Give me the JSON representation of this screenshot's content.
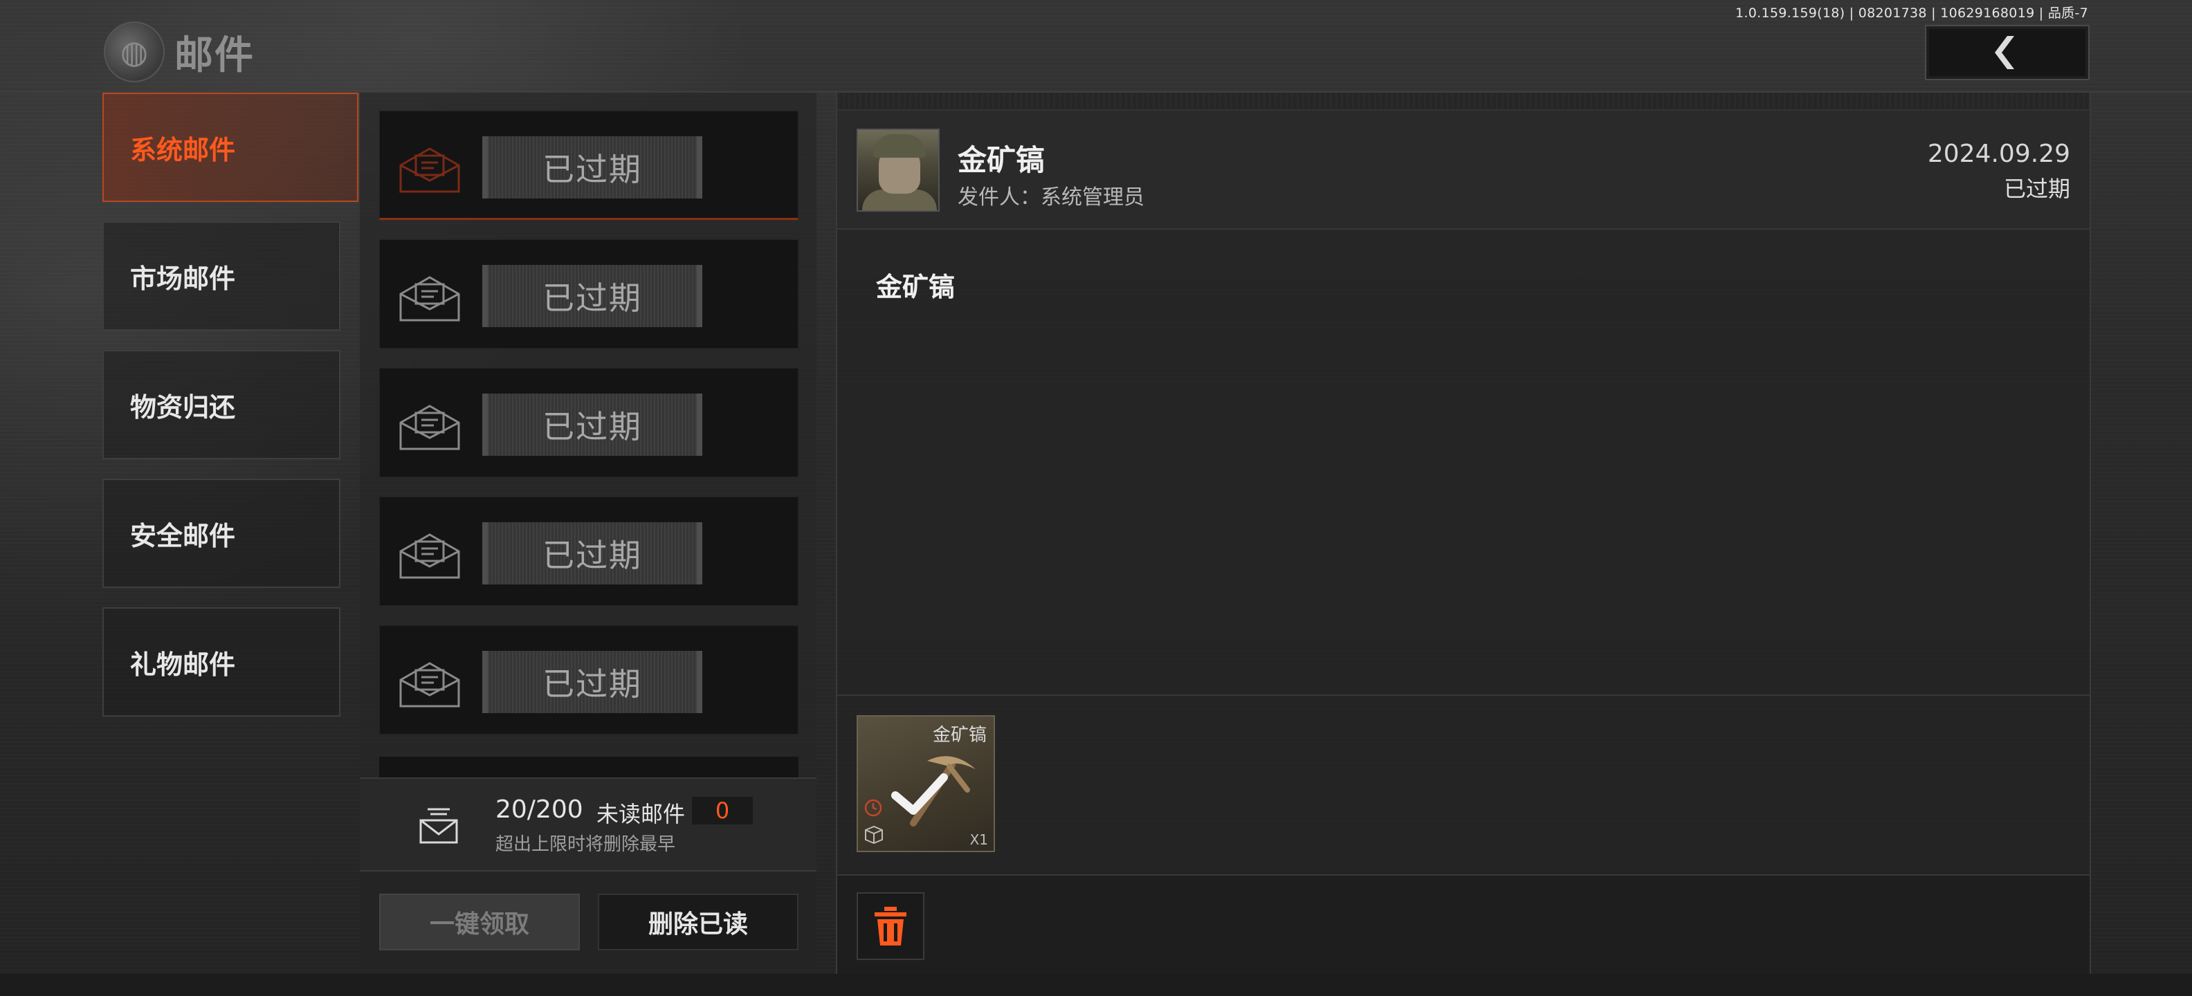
{
  "version_info": "1.0.159.159(18) | 08201738 | 10629168019 | 品质-7",
  "header": {
    "title": "邮件",
    "back_icon": "chevron-left-icon"
  },
  "categories": [
    {
      "label": "系统邮件",
      "active": true
    },
    {
      "label": "市场邮件",
      "active": false
    },
    {
      "label": "物资归还",
      "active": false
    },
    {
      "label": "安全邮件",
      "active": false
    },
    {
      "label": "礼物邮件",
      "active": false
    }
  ],
  "mail_list": {
    "items": [
      {
        "status": "已过期",
        "icon": "open-envelope-icon",
        "selected": true
      },
      {
        "status": "已过期",
        "icon": "open-envelope-icon",
        "selected": false
      },
      {
        "status": "已过期",
        "icon": "open-envelope-icon",
        "selected": false
      },
      {
        "status": "已过期",
        "icon": "open-envelope-icon",
        "selected": false
      },
      {
        "status": "已过期",
        "icon": "open-envelope-icon",
        "selected": false
      }
    ]
  },
  "stats": {
    "count": "20/200",
    "unread_label": "未读邮件",
    "unread_count": "0",
    "note": "超出上限时将删除最早"
  },
  "actions": {
    "claim_all": "一键领取",
    "delete_read": "删除已读"
  },
  "detail": {
    "title": "金矿镐",
    "sender": "发件人：系统管理员",
    "date": "2024.09.29",
    "status": "已过期",
    "body": "金矿镐",
    "attachment": {
      "name": "金矿镐",
      "quantity": "X1",
      "claimed": true
    },
    "delete_icon": "trash-icon"
  },
  "colors": {
    "accent": "#ff5a1e",
    "active_border": "#b8471f",
    "background": "#2a2a2a"
  }
}
